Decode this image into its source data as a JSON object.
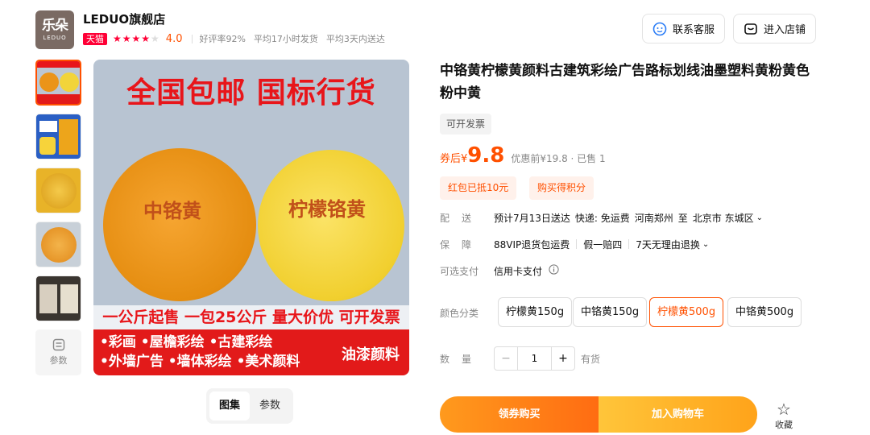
{
  "shop": {
    "logo_text": "乐朵",
    "logo_sub": "LEDUO",
    "name": "LEDUO旗舰店",
    "badge": "天猫",
    "stars": "★★★★★",
    "rating": "4.0",
    "good_rate": "好评率92%",
    "ship_time": "平均17小时发货",
    "deliver_time": "平均3天内送达"
  },
  "header_buttons": {
    "service": "联系客服",
    "store": "进入店铺"
  },
  "gallery": {
    "param_label": "参数",
    "main_headline": "全国包邮 国标行货",
    "left_label": "中铬黄",
    "right_label": "柠檬铬黄",
    "strip": "一公斤起售 一包25公斤 量大价优 可开发票",
    "bottom_row1": "•彩画  •屋檐彩绘  •古建彩绘",
    "bottom_row2": "•外墙广告 •墙体彩绘 •美术颜料",
    "bottom_right": "油漆颜料",
    "tabs": [
      "图集",
      "参数"
    ]
  },
  "product": {
    "title": "中铬黄柠檬黄颜料古建筑彩绘广告路标划线油墨塑料黄粉黄色粉中黄",
    "invoice": "可开发票",
    "price_label": "券后¥",
    "price": "9.8",
    "price_orig": "优惠前¥19.8 · 已售 1",
    "promo1": "红包已抵10元",
    "promo2": "购买得积分"
  },
  "delivery": {
    "label": "配送",
    "eta": "预计7月13日送达",
    "fee": "快递: 免运费",
    "from": "河南郑州",
    "to_word": "至",
    "to": "北京市 东城区"
  },
  "guarantee": {
    "label": "保障",
    "items": [
      "88VIP退货包运费",
      "假一赔四",
      "7天无理由退换"
    ]
  },
  "payment": {
    "label": "可选支付",
    "value": "信用卡支付"
  },
  "color": {
    "label": "颜色分类",
    "options": [
      "柠檬黄150g",
      "中铬黄150g",
      "柠檬黄500g",
      "中铬黄500g"
    ],
    "selected": "柠檬黄500g"
  },
  "quantity": {
    "label": "数量",
    "value": "1",
    "minus": "−",
    "plus": "+",
    "stock": "有货"
  },
  "actions": {
    "buy": "领券购买",
    "cart": "加入购物车",
    "favorite": "收藏"
  },
  "colors": {
    "accent": "#ff5000",
    "tmall": "#ff0036"
  }
}
